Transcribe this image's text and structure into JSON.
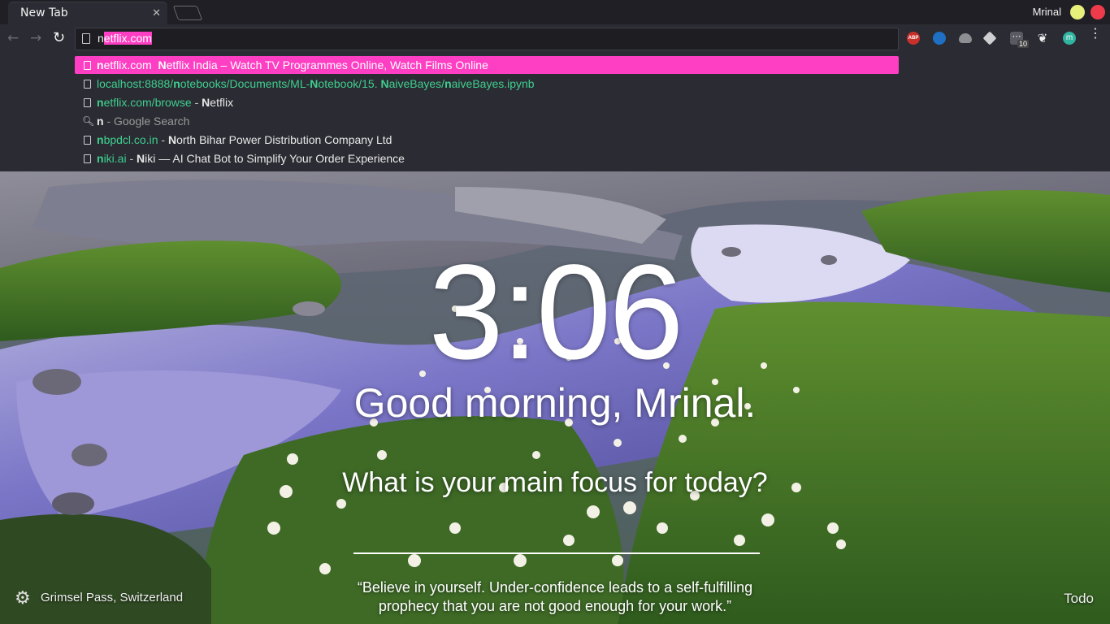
{
  "browser": {
    "tab_title": "New Tab",
    "profile_name": "Mrinal",
    "omnibox": {
      "typed_prefix": "n",
      "autocomplete_selection": "etflix.com"
    },
    "extensions": {
      "abp_label": "ABP",
      "badge_count": "10",
      "m_label": "m"
    }
  },
  "suggestions": [
    {
      "type": "page",
      "url_bold": "n",
      "url_rest": "etflix.com",
      "sep": "  ",
      "title_bold": "N",
      "title_rest": "etflix India – Watch TV Programmes Online, Watch Films Online",
      "selected": true
    },
    {
      "type": "page",
      "url_rest_full": "localhost:8888/notebooks/Documents/ML-Notebook/15. NaiveBayes/naiveBayes.ipynb"
    },
    {
      "type": "page",
      "url_bold": "n",
      "url_rest": "etflix.com/browse",
      "sep": " - ",
      "title_bold": "N",
      "title_rest": "etflix"
    },
    {
      "type": "search",
      "query": "n",
      "hint": " - Google Search"
    },
    {
      "type": "page",
      "url_bold": "n",
      "url_rest": "bpdcl.co.in",
      "sep": " - ",
      "title_bold": "N",
      "title_rest": "orth Bihar Power Distribution Company Ltd"
    },
    {
      "type": "page",
      "url_bold": "n",
      "url_rest": "iki.ai",
      "sep": " - ",
      "title_bold": "N",
      "title_rest": "iki — AI Chat Bot to Simplify Your Order Experience"
    }
  ],
  "momentum": {
    "time": "3:06",
    "greeting": "Good morning, Mrinal.",
    "focus_question": "What is your main focus for today?",
    "quote_line1": "“Believe in yourself. Under-confidence leads to a self-fulfilling",
    "quote_line2": "prophecy that you are not good enough for your work.”",
    "location": "Grimsel Pass, Switzerland",
    "todo": "Todo"
  },
  "colors": {
    "accent": "#ff3fc3",
    "url_green": "#3ecf8e",
    "chrome_dark": "#2b2b33"
  }
}
